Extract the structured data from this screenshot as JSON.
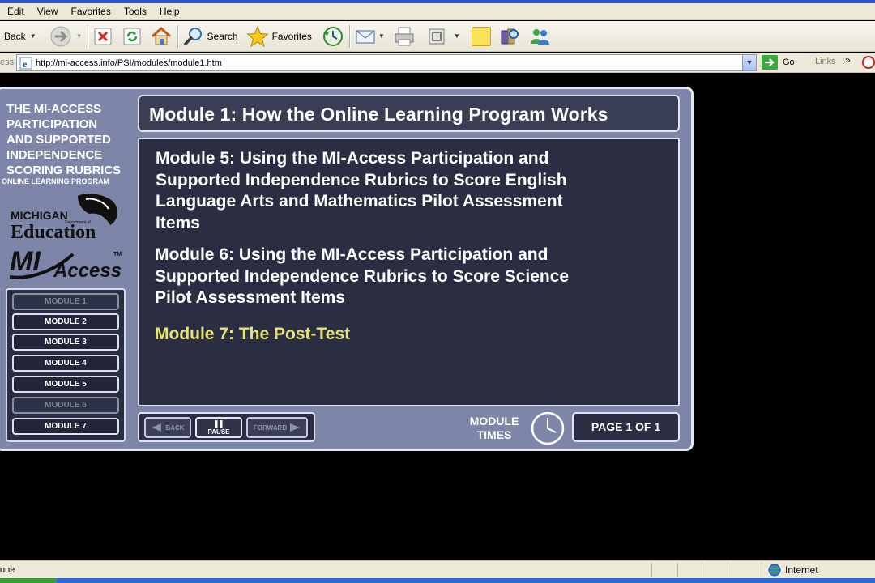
{
  "menu": [
    "Edit",
    "View",
    "Favorites",
    "Tools",
    "Help"
  ],
  "toolbar": {
    "back": "Back",
    "search": "Search",
    "favorites": "Favorites"
  },
  "address": {
    "label": "ess",
    "url": "http://mi-access.info/PSI/modules/module1.htm",
    "go": "Go",
    "links": "Links",
    "more": "»"
  },
  "sidebar": {
    "title_lines": [
      "THE MI-ACCESS",
      "PARTICIPATION",
      "AND SUPPORTED",
      "INDEPENDENCE",
      "SCORING RUBRICS"
    ],
    "subtitle": "ONLINE LEARNING PROGRAM",
    "logo_mde": {
      "top": "MICHIGAN",
      "small": "Department of",
      "big": "Education"
    },
    "logo_mia": {
      "text": "MI",
      "sub": "Access",
      "tm": "TM"
    },
    "modules": [
      {
        "label": "MODULE 1",
        "state": "current"
      },
      {
        "label": "MODULE 2",
        "state": "enabled"
      },
      {
        "label": "MODULE 3",
        "state": "enabled"
      },
      {
        "label": "MODULE 4",
        "state": "enabled"
      },
      {
        "label": "MODULE 5",
        "state": "enabled"
      },
      {
        "label": "MODULE 6",
        "state": "disabled"
      },
      {
        "label": "MODULE 7",
        "state": "enabled"
      }
    ]
  },
  "header": {
    "title": "Module 1:  How the Online Learning Program Works"
  },
  "content": {
    "module5": [
      "Module 5:  Using the MI-Access Participation and",
      "Supported Independence Rubrics to Score English",
      "Language Arts and Mathematics Pilot Assessment",
      "Items"
    ],
    "module6": [
      "Module 6:  Using the MI-Access Participation and",
      "Supported Independence Rubrics to Score Science",
      "Pilot Assessment Items"
    ],
    "module7": "Module 7:  The Post-Test",
    "highlight_color": "#e7e37a"
  },
  "nav": {
    "back": "BACK",
    "pause": "PAUSE",
    "forward": "FORWARD",
    "times": [
      "MODULE",
      "TIMES"
    ],
    "page": "PAGE 1 OF 1"
  },
  "status": {
    "text": "one",
    "zone": "Internet"
  }
}
